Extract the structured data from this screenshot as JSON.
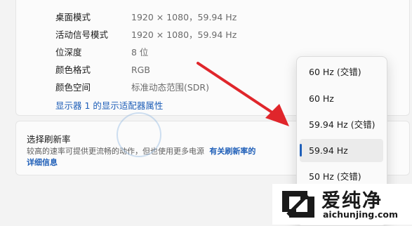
{
  "display_info": {
    "rows": [
      {
        "label": "桌面模式",
        "value": "1920 × 1080，59.94 Hz"
      },
      {
        "label": "活动信号模式",
        "value": "1920 × 1080，59.94 Hz"
      },
      {
        "label": "位深度",
        "value": "8 位"
      },
      {
        "label": "颜色格式",
        "value": "RGB"
      },
      {
        "label": "颜色空间",
        "value": "标准动态范围(SDR)"
      }
    ],
    "adapter_link": "显示器 1 的显示适配器属性"
  },
  "refresh_rate": {
    "title": "选择刷新率",
    "description": "较高的速率可提供更流畅的动作，但也使用更多电源",
    "learn_more_part1": "有关刷新率的",
    "learn_more_part2": "详细信息",
    "options": [
      "60 Hz (交错)",
      "60 Hz",
      "59.94 Hz (交错)",
      "59.94 Hz",
      "50 Hz (交错)"
    ],
    "selected": "59.94 Hz"
  },
  "watermark": {
    "logo_text": "爱纯净",
    "site": "aichunjing.com"
  },
  "colors": {
    "accent": "#1f5fb8",
    "arrow": "#e0262b"
  }
}
